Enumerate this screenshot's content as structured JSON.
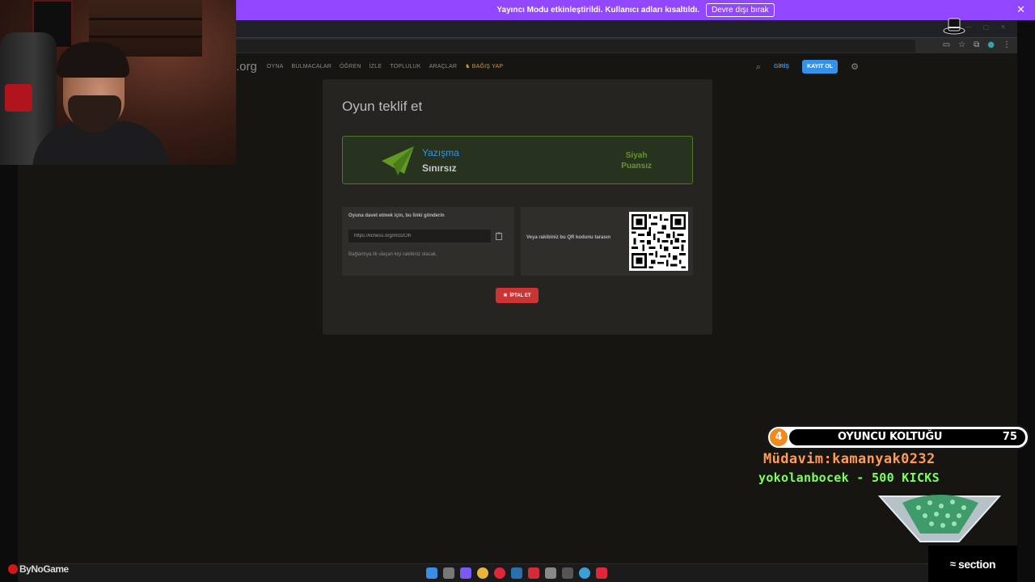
{
  "notification": {
    "text": "Yayıncı Modu etkinleştirildi. Kullanıcı adları kısaltıldı.",
    "button": "Devre dışı bırak"
  },
  "site": {
    "logo": ".org",
    "nav": [
      "OYNA",
      "BULMACALAR",
      "ÖĞREN",
      "İZLE",
      "TOPLULUK",
      "ARAÇLAR"
    ],
    "donate": "BAĞIŞ YAP",
    "login": "GİRİŞ",
    "signup": "KAYIT OL"
  },
  "modal": {
    "title": "Oyun teklif et",
    "variant": "Yazışma",
    "time_control": "Sınırsız",
    "color": "Siyah",
    "rated": "Puansız",
    "invite_title": "Oyuna davet etmek için, bu linki gönderin",
    "invite_link": "https://lichess.org/mcl2Cfh",
    "invite_note": "Bağlantıya ilk ulaşan kişi rakibiniz olacak.",
    "qr_text": "Veya rakibiniz bu QR kodunu tarasın",
    "cancel": "İPTAL ET"
  },
  "overlay": {
    "seat_number": "4",
    "seat_label": "OYUNCU KOLTUĞU",
    "seat_count": "75",
    "regular": "Müdavim:kamanyak0232",
    "kicks": "yokolanbocek - 500 KICKS",
    "sponsor": "section",
    "brand": "ByNoGame"
  },
  "colors": {
    "notification_bg": "#9146ff",
    "accent_blue": "#3692e7",
    "accent_green": "#629924",
    "cancel_red": "#cc3333",
    "seat_orange": "#f08a1f"
  }
}
